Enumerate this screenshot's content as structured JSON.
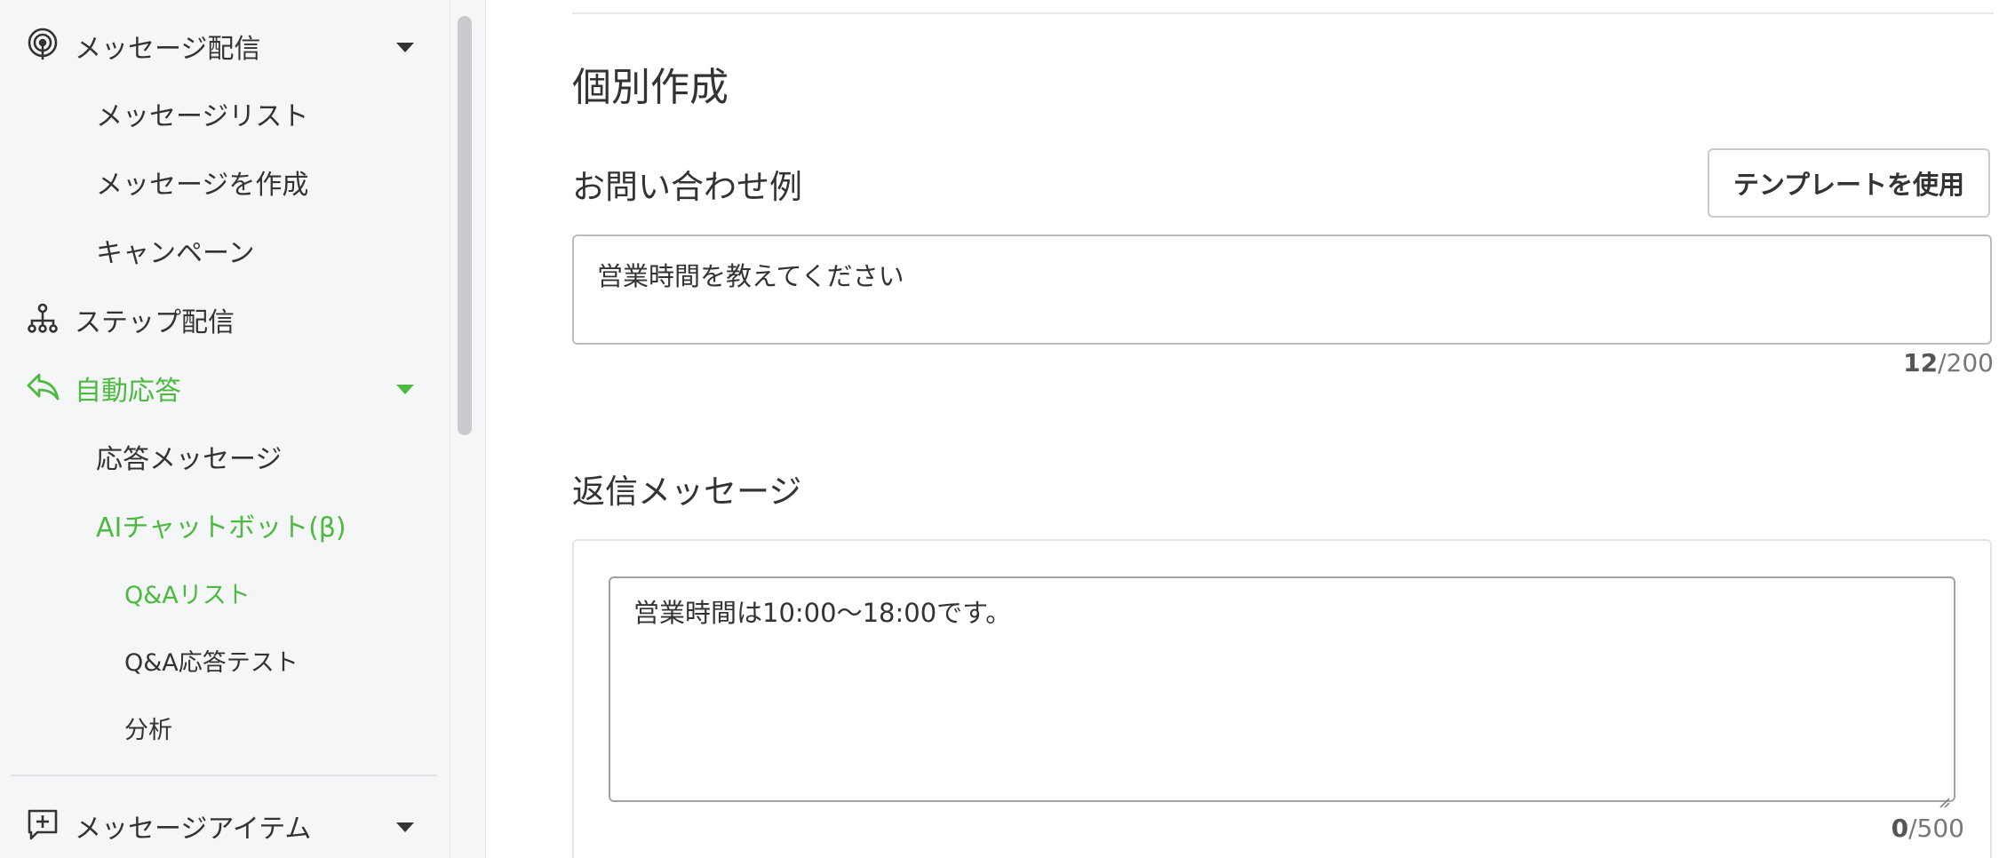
{
  "sidebar": {
    "message_delivery": {
      "label": "メッセージ配信",
      "icon": "broadcast-icon",
      "expanded": true
    },
    "message_list": {
      "label": "メッセージリスト"
    },
    "create_message": {
      "label": "メッセージを作成"
    },
    "campaign": {
      "label": "キャンペーン"
    },
    "step_delivery": {
      "label": "ステップ配信",
      "icon": "step-tree-icon"
    },
    "auto_reply": {
      "label": "自動応答",
      "icon": "reply-arrow-icon",
      "expanded": true,
      "active": true
    },
    "response_message": {
      "label": "応答メッセージ"
    },
    "ai_chatbot": {
      "label": "AIチャットボット(β)",
      "active": true
    },
    "qa_list": {
      "label": "Q&Aリスト",
      "active": true
    },
    "qa_test": {
      "label": "Q&A応答テスト"
    },
    "analysis": {
      "label": "分析"
    },
    "message_items": {
      "label": "メッセージアイテム",
      "icon": "add-message-icon"
    }
  },
  "main": {
    "title": "個別作成",
    "inquiry": {
      "label": "お問い合わせ例",
      "template_button": "テンプレートを使用",
      "value": "営業時間を教えてください",
      "count": "12",
      "max": "/200"
    },
    "reply": {
      "label": "返信メッセージ",
      "value": "営業時間は10:00〜18:00です。",
      "count": "0",
      "max": "/500"
    }
  },
  "colors": {
    "accent": "#4cb93f",
    "text": "#333333",
    "sidebar_bg": "#f5f6f7"
  }
}
